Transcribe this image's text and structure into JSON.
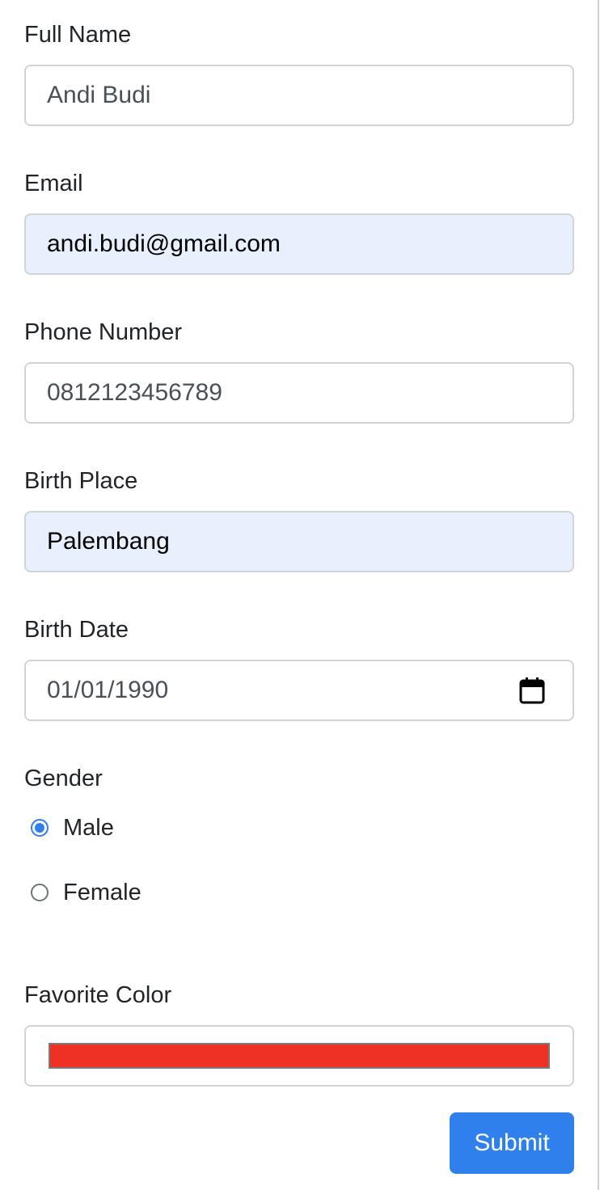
{
  "form": {
    "full_name": {
      "label": "Full Name",
      "value": "Andi Budi"
    },
    "email": {
      "label": "Email",
      "value": "andi.budi@gmail.com"
    },
    "phone": {
      "label": "Phone Number",
      "value": "0812123456789"
    },
    "birth_place": {
      "label": "Birth Place",
      "value": "Palembang"
    },
    "birth_date": {
      "label": "Birth Date",
      "value": "01/01/1990"
    },
    "gender": {
      "label": "Gender",
      "options": [
        {
          "label": "Male",
          "checked": true
        },
        {
          "label": "Female",
          "checked": false
        }
      ]
    },
    "favorite_color": {
      "label": "Favorite Color",
      "value": "#ee3124"
    },
    "submit_label": "Submit"
  },
  "colors": {
    "primary": "#2f80ed",
    "autofill_bg": "#e8f0fe"
  },
  "icons": {
    "birth_date": "calendar-icon"
  }
}
